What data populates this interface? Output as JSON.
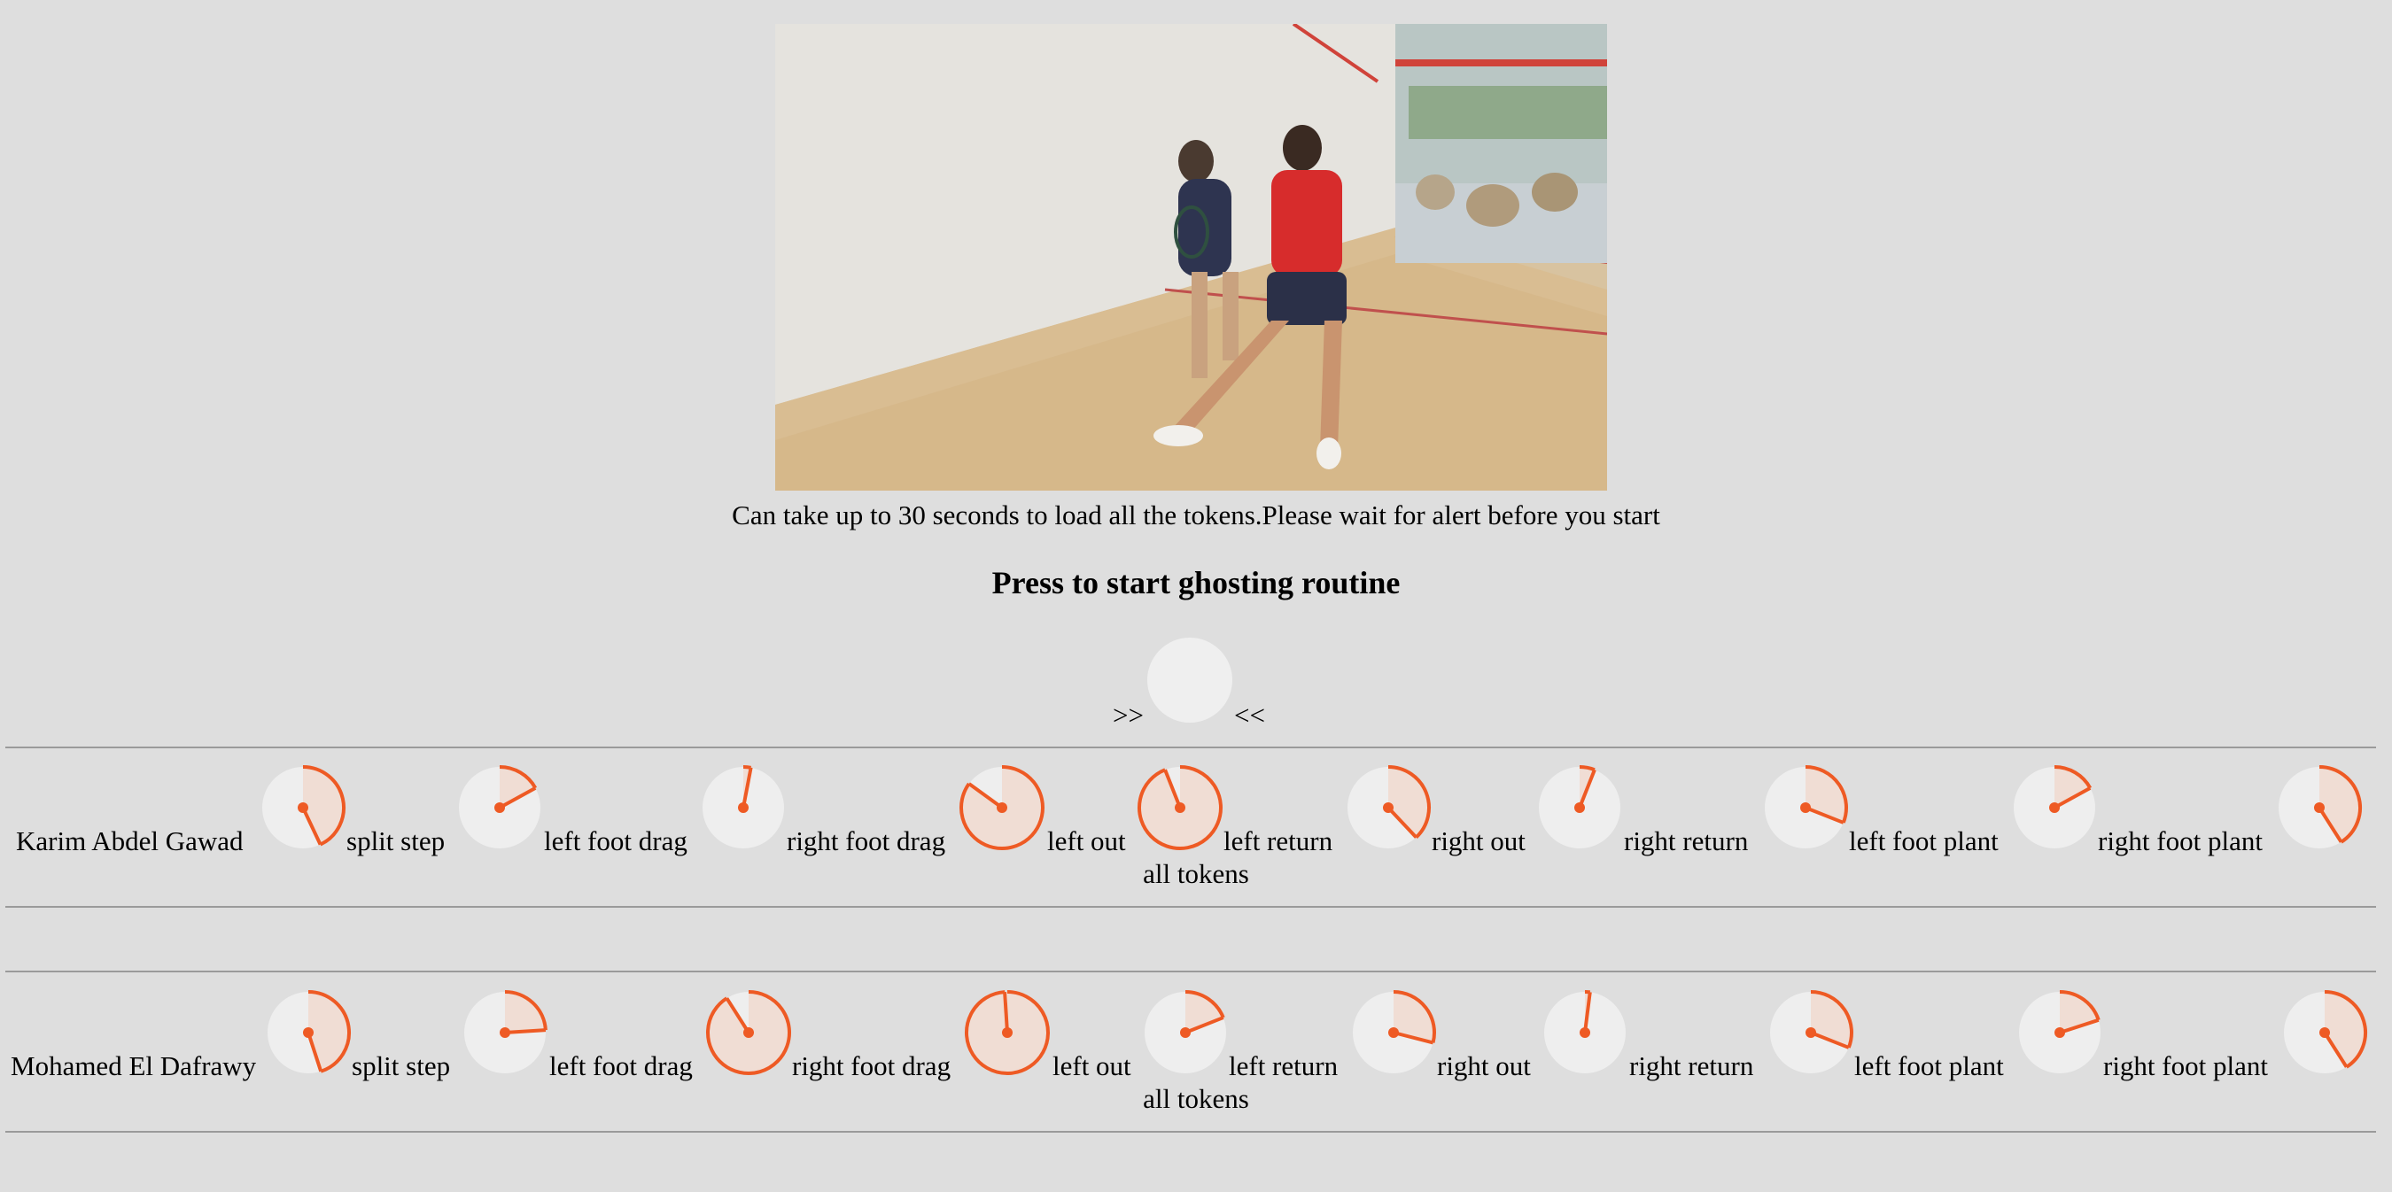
{
  "page": {
    "loading_note": "Can take up to 30 seconds to load all the tokens.Please wait for alert before you start",
    "start_heading": "Press to start ghosting routine",
    "forward_arrow": ">>",
    "back_arrow": "<<"
  },
  "theme": {
    "accent": "#ee5a24",
    "dial_fill": "#f0ddd4",
    "dial_background": "#eeeeee",
    "page_background": "#dedede"
  },
  "players": [
    {
      "name": "Karim Abdel Gawad",
      "all_tokens_label": "all tokens",
      "tokens": [
        {
          "label": "split step",
          "progress": 0.43
        },
        {
          "label": "left foot drag",
          "progress": 0.17
        },
        {
          "label": "right foot drag",
          "progress": 0.03
        },
        {
          "label": "left out",
          "progress": 0.85
        },
        {
          "label": "left return",
          "progress": 0.94
        },
        {
          "label": "right out",
          "progress": 0.38
        },
        {
          "label": "right return",
          "progress": 0.06
        },
        {
          "label": "left foot plant",
          "progress": 0.31
        },
        {
          "label": "right foot plant",
          "progress": 0.17
        },
        {
          "label": "",
          "progress": 0.41
        }
      ]
    },
    {
      "name": "Mohamed El Dafrawy",
      "all_tokens_label": "all tokens",
      "tokens": [
        {
          "label": "split step",
          "progress": 0.45
        },
        {
          "label": "left foot drag",
          "progress": 0.24
        },
        {
          "label": "right foot drag",
          "progress": 0.91
        },
        {
          "label": "left out",
          "progress": 0.99
        },
        {
          "label": "left return",
          "progress": 0.19
        },
        {
          "label": "right out",
          "progress": 0.29
        },
        {
          "label": "right return",
          "progress": 0.02
        },
        {
          "label": "left foot plant",
          "progress": 0.31
        },
        {
          "label": "right foot plant",
          "progress": 0.2
        },
        {
          "label": "",
          "progress": 0.41
        }
      ]
    }
  ]
}
